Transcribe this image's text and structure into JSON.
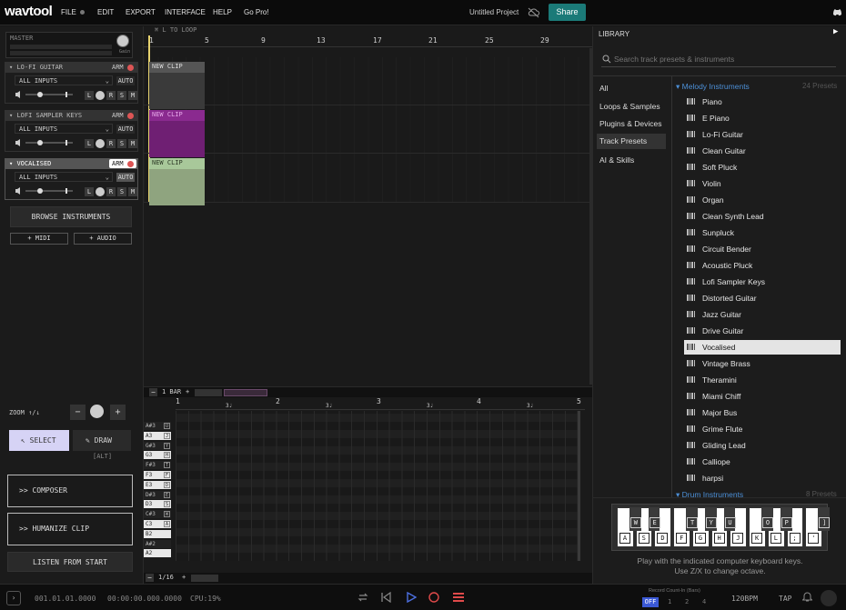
{
  "header": {
    "logo": "wavtool",
    "menu": [
      "FILE",
      "EDIT",
      "EXPORT",
      "INTERFACE",
      "HELP",
      "Go Pro!"
    ],
    "project_name": "Untitled Project",
    "share_label": "Share"
  },
  "master": {
    "label": "MASTER",
    "gain_label": "Gain"
  },
  "tracks": [
    {
      "name": "LO-FI GUITAR",
      "input": "ALL INPUTS",
      "arm": "ARM",
      "auto": "AUTO",
      "color": "#8a8a8a"
    },
    {
      "name": "LOFI SAMPLER KEYS",
      "input": "ALL INPUTS",
      "arm": "ARM",
      "auto": "AUTO",
      "color": "#b23ab7"
    },
    {
      "name": "VOCALISED",
      "input": "ALL INPUTS",
      "arm": "ARM",
      "auto": "AUTO",
      "color": "#a8c89a"
    }
  ],
  "track_buttons": {
    "l": "L",
    "r": "R",
    "s": "S",
    "m": "M"
  },
  "browse_label": "BROWSE INSTRUMENTS",
  "add_midi": "+ MIDI",
  "add_audio": "+ AUDIO",
  "arrange": {
    "loop_hint": "⌘ L TO LOOP",
    "ruler": [
      "1",
      "5",
      "9",
      "13",
      "17",
      "21",
      "25",
      "29"
    ],
    "clip_label": "NEW CLIP",
    "bar_label": "1 BAR"
  },
  "editor": {
    "zoom_label": "ZOOM ↑/↓",
    "select_label": "SELECT",
    "draw_label": "DRAW",
    "alt_label": "[ALT]",
    "composer_label": ">>  COMPOSER",
    "humanize_label": ">>  HUMANIZE CLIP",
    "listen_label": "LISTEN FROM START",
    "ruler": [
      "1",
      "2",
      "3",
      "4",
      "5"
    ],
    "sub_ruler": "3♩",
    "grid_label": "1/16",
    "keys": [
      {
        "note": "A#3",
        "letter": "U"
      },
      {
        "note": "A3",
        "letter": "J"
      },
      {
        "note": "G#3",
        "letter": "Y"
      },
      {
        "note": "G3",
        "letter": "H"
      },
      {
        "note": "F#3",
        "letter": "T"
      },
      {
        "note": "F3",
        "letter": "F"
      },
      {
        "note": "E3",
        "letter": "D"
      },
      {
        "note": "D#3",
        "letter": "E"
      },
      {
        "note": "D3",
        "letter": "S"
      },
      {
        "note": "C#3",
        "letter": "W"
      },
      {
        "note": "C3",
        "letter": "A"
      },
      {
        "note": "B2",
        "letter": ""
      },
      {
        "note": "A#2",
        "letter": ""
      },
      {
        "note": "A2",
        "letter": ""
      }
    ]
  },
  "library": {
    "title": "LIBRARY",
    "search_placeholder": "Search track presets & instruments",
    "categories": [
      "All",
      "Loops & Samples",
      "Plugins & Devices",
      "Track Presets",
      "AI & Skills"
    ],
    "selected_category": "Track Presets",
    "section1": {
      "name": "Melody Instruments",
      "count": "24 Presets"
    },
    "presets": [
      "Piano",
      "E Piano",
      "Lo-Fi Guitar",
      "Clean Guitar",
      "Soft Pluck",
      "Violin",
      "Organ",
      "Clean Synth Lead",
      "Sunpluck",
      "Circuit Bender",
      "Acoustic Pluck",
      "Lofi Sampler Keys",
      "Distorted Guitar",
      "Jazz Guitar",
      "Drive Guitar",
      "Vocalised",
      "Vintage Brass",
      "Theramini",
      "Miami Chiff",
      "Major Bus",
      "Grime Flute",
      "Gliding Lead",
      "Calliope",
      "harpsi"
    ],
    "selected_preset": "Vocalised",
    "section2": {
      "name": "Drum Instruments",
      "count": "8 Presets"
    },
    "white_keys": [
      "A",
      "S",
      "D",
      "F",
      "G",
      "H",
      "J",
      "K",
      "L",
      ";",
      "'"
    ],
    "black_keys": [
      "W",
      "E",
      "T",
      "Y",
      "U",
      "O",
      "P",
      "]"
    ],
    "keyboard_hint_1": "Play with the indicated computer keyboard keys.",
    "keyboard_hint_2": "Use Z/X to change octave.",
    "accent": "#4c8fd6"
  },
  "status": {
    "position": "001.01.01.0000",
    "time": "00:00:00.000.0000",
    "cpu": "CPU:19%",
    "count_in_label": "Record Count-In (Bars)",
    "count_in_options": [
      "OFF",
      "1",
      "2",
      "4"
    ],
    "bpm": "120BPM",
    "tap": "TAP"
  }
}
